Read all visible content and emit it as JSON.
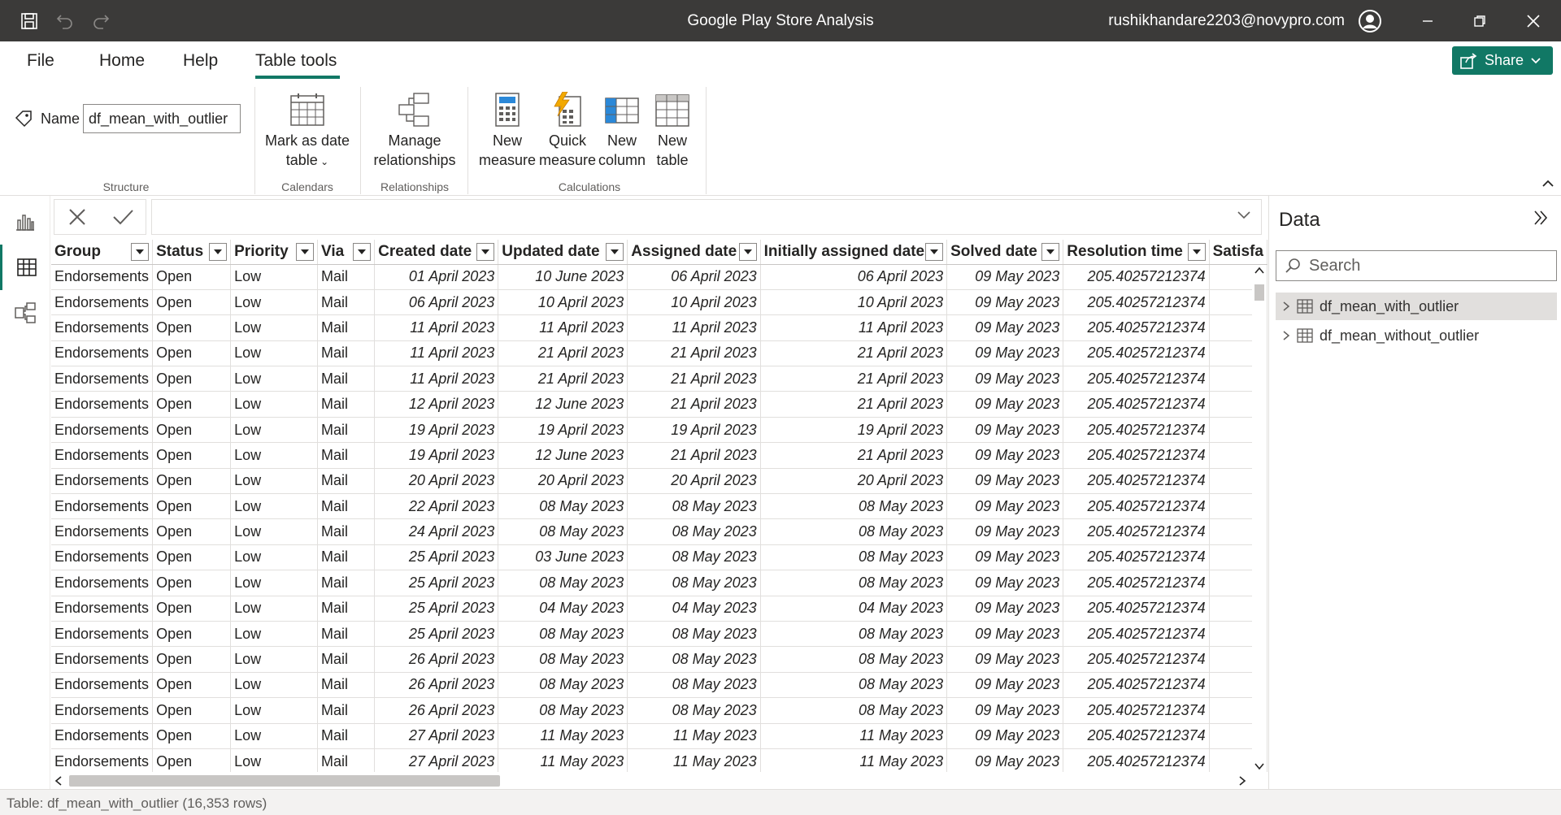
{
  "titlebar": {
    "title": "Google Play Store Analysis",
    "user": "rushikhandare2203@novypro.com"
  },
  "ribbon_tabs": [
    {
      "label": "File"
    },
    {
      "label": "Home"
    },
    {
      "label": "Help"
    },
    {
      "label": "Table tools",
      "active": true
    }
  ],
  "share_label": "Share",
  "ribbon": {
    "name_label": "Name",
    "name_value": "df_mean_with_outlier",
    "groups": {
      "structure": "Structure",
      "calendars": "Calendars",
      "relationships": "Relationships",
      "calculations": "Calculations"
    },
    "mark_date": {
      "line1": "Mark as date",
      "line2": "table"
    },
    "manage_rel": {
      "line1": "Manage",
      "line2": "relationships"
    },
    "new_measure": {
      "line1": "New",
      "line2": "measure"
    },
    "quick_measure": {
      "line1": "Quick",
      "line2": "measure"
    },
    "new_column": {
      "line1": "New",
      "line2": "column"
    },
    "new_table": {
      "line1": "New",
      "line2": "table"
    }
  },
  "grid": {
    "columns": [
      "Group",
      "Status",
      "Priority",
      "Via",
      "Created date",
      "Updated date",
      "Assigned date",
      "Initially assigned date",
      "Solved date",
      "Resolution time",
      "Satisfa"
    ],
    "rows": [
      [
        "Endorsements",
        "Open",
        "Low",
        "Mail",
        "01 April 2023",
        "10 June 2023",
        "06 April 2023",
        "06 April 2023",
        "09 May 2023",
        "205.40257212374"
      ],
      [
        "Endorsements",
        "Open",
        "Low",
        "Mail",
        "06 April 2023",
        "10 April 2023",
        "10 April 2023",
        "10 April 2023",
        "09 May 2023",
        "205.40257212374"
      ],
      [
        "Endorsements",
        "Open",
        "Low",
        "Mail",
        "11 April 2023",
        "11 April 2023",
        "11 April 2023",
        "11 April 2023",
        "09 May 2023",
        "205.40257212374"
      ],
      [
        "Endorsements",
        "Open",
        "Low",
        "Mail",
        "11 April 2023",
        "21 April 2023",
        "21 April 2023",
        "21 April 2023",
        "09 May 2023",
        "205.40257212374"
      ],
      [
        "Endorsements",
        "Open",
        "Low",
        "Mail",
        "11 April 2023",
        "21 April 2023",
        "21 April 2023",
        "21 April 2023",
        "09 May 2023",
        "205.40257212374"
      ],
      [
        "Endorsements",
        "Open",
        "Low",
        "Mail",
        "12 April 2023",
        "12 June 2023",
        "21 April 2023",
        "21 April 2023",
        "09 May 2023",
        "205.40257212374"
      ],
      [
        "Endorsements",
        "Open",
        "Low",
        "Mail",
        "19 April 2023",
        "19 April 2023",
        "19 April 2023",
        "19 April 2023",
        "09 May 2023",
        "205.40257212374"
      ],
      [
        "Endorsements",
        "Open",
        "Low",
        "Mail",
        "19 April 2023",
        "12 June 2023",
        "21 April 2023",
        "21 April 2023",
        "09 May 2023",
        "205.40257212374"
      ],
      [
        "Endorsements",
        "Open",
        "Low",
        "Mail",
        "20 April 2023",
        "20 April 2023",
        "20 April 2023",
        "20 April 2023",
        "09 May 2023",
        "205.40257212374"
      ],
      [
        "Endorsements",
        "Open",
        "Low",
        "Mail",
        "22 April 2023",
        "08 May 2023",
        "08 May 2023",
        "08 May 2023",
        "09 May 2023",
        "205.40257212374"
      ],
      [
        "Endorsements",
        "Open",
        "Low",
        "Mail",
        "24 April 2023",
        "08 May 2023",
        "08 May 2023",
        "08 May 2023",
        "09 May 2023",
        "205.40257212374"
      ],
      [
        "Endorsements",
        "Open",
        "Low",
        "Mail",
        "25 April 2023",
        "03 June 2023",
        "08 May 2023",
        "08 May 2023",
        "09 May 2023",
        "205.40257212374"
      ],
      [
        "Endorsements",
        "Open",
        "Low",
        "Mail",
        "25 April 2023",
        "08 May 2023",
        "08 May 2023",
        "08 May 2023",
        "09 May 2023",
        "205.40257212374"
      ],
      [
        "Endorsements",
        "Open",
        "Low",
        "Mail",
        "25 April 2023",
        "04 May 2023",
        "04 May 2023",
        "04 May 2023",
        "09 May 2023",
        "205.40257212374"
      ],
      [
        "Endorsements",
        "Open",
        "Low",
        "Mail",
        "25 April 2023",
        "08 May 2023",
        "08 May 2023",
        "08 May 2023",
        "09 May 2023",
        "205.40257212374"
      ],
      [
        "Endorsements",
        "Open",
        "Low",
        "Mail",
        "26 April 2023",
        "08 May 2023",
        "08 May 2023",
        "08 May 2023",
        "09 May 2023",
        "205.40257212374"
      ],
      [
        "Endorsements",
        "Open",
        "Low",
        "Mail",
        "26 April 2023",
        "08 May 2023",
        "08 May 2023",
        "08 May 2023",
        "09 May 2023",
        "205.40257212374"
      ],
      [
        "Endorsements",
        "Open",
        "Low",
        "Mail",
        "26 April 2023",
        "08 May 2023",
        "08 May 2023",
        "08 May 2023",
        "09 May 2023",
        "205.40257212374"
      ],
      [
        "Endorsements",
        "Open",
        "Low",
        "Mail",
        "27 April 2023",
        "11 May 2023",
        "11 May 2023",
        "11 May 2023",
        "09 May 2023",
        "205.40257212374"
      ],
      [
        "Endorsements",
        "Open",
        "Low",
        "Mail",
        "27 April 2023",
        "11 May 2023",
        "11 May 2023",
        "11 May 2023",
        "09 May 2023",
        "205.40257212374"
      ]
    ]
  },
  "datapane": {
    "title": "Data",
    "search_placeholder": "Search",
    "tables": [
      "df_mean_with_outlier",
      "df_mean_without_outlier"
    ]
  },
  "statusbar": {
    "text": "Table: df_mean_with_outlier (16,353 rows)"
  },
  "colors": {
    "accent": "#117865",
    "titlebar": "#3b3a39"
  }
}
